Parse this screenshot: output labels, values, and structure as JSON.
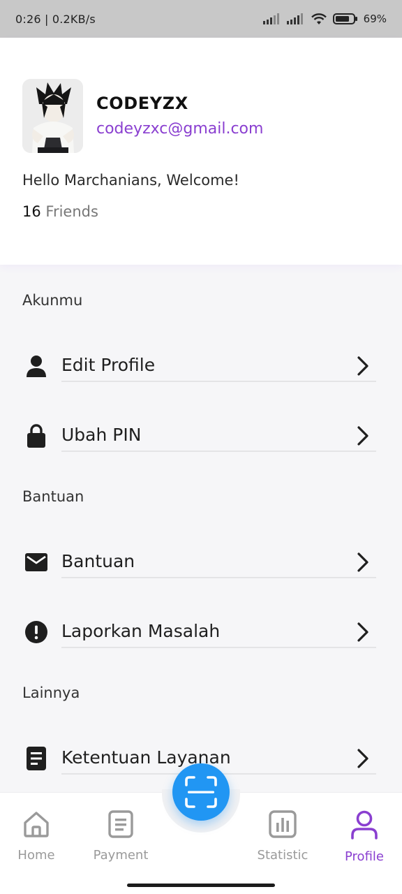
{
  "status_bar": {
    "time_speed": "0:26 | 0.2KB/s",
    "battery": "69%"
  },
  "profile": {
    "username": "CODEYZX",
    "email": "codeyzxc@gmail.com",
    "welcome": "Hello Marchanians, Welcome!",
    "friends_count": "16",
    "friends_label": " Friends"
  },
  "sections": [
    {
      "title": "Akunmu",
      "items": [
        {
          "label": "Edit Profile",
          "icon": "person-icon"
        },
        {
          "label": "Ubah PIN",
          "icon": "lock-icon"
        }
      ]
    },
    {
      "title": "Bantuan",
      "items": [
        {
          "label": "Bantuan",
          "icon": "mail-icon"
        },
        {
          "label": "Laporkan Masalah",
          "icon": "alert-icon"
        }
      ]
    },
    {
      "title": "Lainnya",
      "items": [
        {
          "label": "Ketentuan Layanan",
          "icon": "document-icon"
        }
      ]
    }
  ],
  "bottom_nav": {
    "items": [
      {
        "label": "Home",
        "icon": "home-icon"
      },
      {
        "label": "Payment",
        "icon": "receipt-icon"
      },
      {
        "label": "Statistic",
        "icon": "chart-icon"
      },
      {
        "label": "Profile",
        "icon": "profile-icon",
        "active": true
      }
    ],
    "scan_icon": "scan-icon"
  },
  "colors": {
    "accent": "#8a3fd0",
    "fab": "#2196f3",
    "status_bar": "#c8c8c8"
  }
}
